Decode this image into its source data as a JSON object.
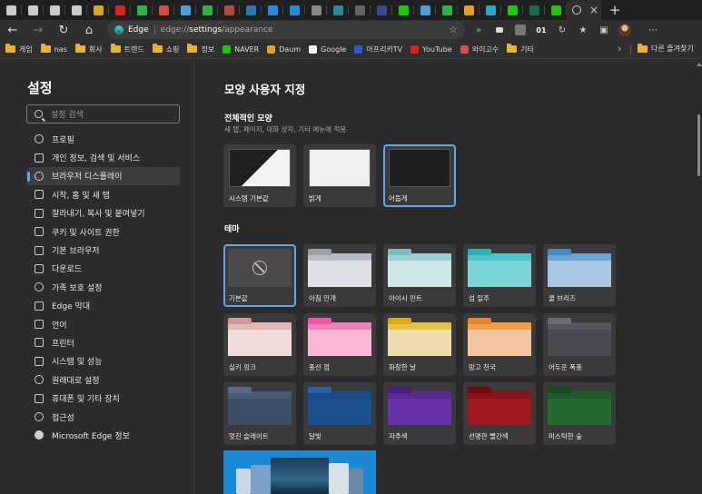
{
  "browser": {
    "tabs": [
      {
        "icon": "tab-actions-icon",
        "color": "#cccccc"
      },
      {
        "icon": "page-icon",
        "color": "#cccccc"
      },
      {
        "icon": "page-icon",
        "color": "#cccccc"
      },
      {
        "icon": "page-icon",
        "color": "#cccccc"
      },
      {
        "icon": "pac-icon",
        "color": "#d9a520"
      },
      {
        "icon": "youtube-icon",
        "color": "#e02020"
      },
      {
        "icon": "green-app-icon",
        "color": "#2db34a"
      },
      {
        "icon": "mail-icon",
        "color": "#d64b3a"
      },
      {
        "icon": "pinwheel-icon",
        "color": "#4aa0d8"
      },
      {
        "icon": "green-app-icon",
        "color": "#2db34a"
      },
      {
        "icon": "red-app-icon",
        "color": "#b44b3a"
      },
      {
        "icon": "wave-icon",
        "color": "#2a7ab8"
      },
      {
        "icon": "cloud-icon",
        "color": "#2a8cd8"
      },
      {
        "icon": "cloud-icon",
        "color": "#2a8cd8"
      },
      {
        "icon": "slash-icon",
        "color": "#888888"
      },
      {
        "icon": "globe-icon",
        "color": "#2a8a9a"
      },
      {
        "icon": "image-icon",
        "color": "#666666"
      },
      {
        "icon": "film-icon",
        "color": "#3a4a8a"
      },
      {
        "icon": "naver-icon",
        "color": "#1ec800"
      },
      {
        "icon": "pinwheel-icon",
        "color": "#4aa0d8"
      },
      {
        "icon": "green-app-icon",
        "color": "#2db34a"
      },
      {
        "icon": "bars-icon",
        "color": "#e0a020"
      },
      {
        "icon": "cyan-app-icon",
        "color": "#2aa8c8"
      },
      {
        "icon": "naver-icon",
        "color": "#1ec800"
      },
      {
        "icon": "leaf-icon",
        "color": "#1b6b4f"
      },
      {
        "icon": "naver-icon",
        "color": "#1ec800"
      }
    ],
    "active_tab_icon": "settings-icon",
    "address": {
      "site_label": "Edge",
      "url_prefix": "edge://",
      "url_bold": "settings",
      "url_suffix": "/appearance"
    },
    "toolbar_label_01": "01",
    "favorites": [
      {
        "type": "folder",
        "label": "게임"
      },
      {
        "type": "folder",
        "label": "nas"
      },
      {
        "type": "folder",
        "label": "회사"
      },
      {
        "type": "folder",
        "label": "트렌드"
      },
      {
        "type": "folder",
        "label": "쇼핑"
      },
      {
        "type": "folder",
        "label": "정보"
      },
      {
        "type": "site",
        "label": "NAVER",
        "color": "#1ec800"
      },
      {
        "type": "site",
        "label": "Daum",
        "color": "#e8a020"
      },
      {
        "type": "site",
        "label": "Google",
        "color": "#ffffff"
      },
      {
        "type": "site",
        "label": "아프리카TV",
        "color": "#2a5ad8"
      },
      {
        "type": "site",
        "label": "YouTube",
        "color": "#e02020"
      },
      {
        "type": "site",
        "label": "와이고수",
        "color": "#d84a5a"
      },
      {
        "type": "folder",
        "label": "기타"
      }
    ],
    "other_favorites": "다른 즐겨찾기"
  },
  "sidebar": {
    "title": "설정",
    "search_placeholder": "설정 검색",
    "items": [
      {
        "label": "프로필",
        "name": "profile",
        "icon": "round"
      },
      {
        "label": "개인 정보, 검색 및 서비스",
        "name": "privacy",
        "icon": "lock"
      },
      {
        "label": "브라우저 디스플레이",
        "name": "appearance",
        "icon": "round",
        "active": true
      },
      {
        "label": "시작, 홈 및 새 탭",
        "name": "start-home",
        "icon": "square"
      },
      {
        "label": "잘라내기, 복사 및 붙여넣기",
        "name": "share-copy-paste",
        "icon": "square"
      },
      {
        "label": "쿠키 및 사이트 권한",
        "name": "cookies",
        "icon": "square"
      },
      {
        "label": "기본 브라우저",
        "name": "default-browser",
        "icon": "square"
      },
      {
        "label": "다운로드",
        "name": "downloads",
        "icon": "arrow"
      },
      {
        "label": "가족 보호 설정",
        "name": "family",
        "icon": "round"
      },
      {
        "label": "Edge 막대",
        "name": "edge-bar",
        "icon": "square"
      },
      {
        "label": "언어",
        "name": "languages",
        "icon": "square"
      },
      {
        "label": "프린터",
        "name": "printers",
        "icon": "square"
      },
      {
        "label": "시스템 및 성능",
        "name": "system",
        "icon": "square"
      },
      {
        "label": "원래대로 설정",
        "name": "reset",
        "icon": "round"
      },
      {
        "label": "휴대폰 및 기타 장치",
        "name": "phone",
        "icon": "square"
      },
      {
        "label": "접근성",
        "name": "accessibility",
        "icon": "round"
      },
      {
        "label": "Microsoft Edge 정보",
        "name": "about",
        "icon": "solid"
      }
    ]
  },
  "main": {
    "title": "모양 사용자 지정",
    "overall": {
      "heading": "전체적인 모양",
      "subtext": "새 탭, 페이지, 대화 상자, 기타 메뉴에 적용",
      "options": [
        {
          "label": "시스템 기본값",
          "name": "system-default",
          "selected": false
        },
        {
          "label": "밝게",
          "name": "light",
          "selected": false
        },
        {
          "label": "어둡게",
          "name": "dark",
          "selected": true
        }
      ]
    },
    "theme": {
      "heading": "테마",
      "items": [
        {
          "label": "기본값",
          "name": "default",
          "band": "#4a4a4a",
          "body": "#4a4a4a",
          "tab": "#4a4a4a",
          "selected": true,
          "none": true
        },
        {
          "label": "아침 안개",
          "name": "morning-fog",
          "band": "#b8bcc4",
          "body": "#dfe1e6",
          "tab": "#9aa0aa"
        },
        {
          "label": "아이시 민트",
          "name": "icy-mint",
          "band": "#9fd0d4",
          "body": "#cfe6e8",
          "tab": "#7cbcc2"
        },
        {
          "label": "섬 일주",
          "name": "island-getaway",
          "band": "#4cc6c8",
          "body": "#7ad6d6",
          "tab": "#2fb0b8"
        },
        {
          "label": "쿨 브리즈",
          "name": "cool-breeze",
          "band": "#6aa4d4",
          "body": "#a9c6e2",
          "tab": "#4a88c4"
        },
        {
          "label": "실키 핑크",
          "name": "silky-pink",
          "band": "#e2b8b8",
          "body": "#f1dcdc",
          "tab": "#d09a9a"
        },
        {
          "label": "풍선 껌",
          "name": "bubblegum",
          "band": "#f27db8",
          "body": "#f8b6d4",
          "tab": "#ea5aa4"
        },
        {
          "label": "화창한 날",
          "name": "sunny-day",
          "band": "#e6c23a",
          "body": "#ecdcae",
          "tab": "#d8a91a"
        },
        {
          "label": "망고 천국",
          "name": "mango-paradise",
          "band": "#f0a040",
          "body": "#f2c6a0",
          "tab": "#e4862a"
        },
        {
          "label": "어두운 폭풍",
          "name": "dark-storm",
          "band": "#56565e",
          "body": "#4a4a52",
          "tab": "#6a6a72"
        },
        {
          "label": "멋진 슬레이트",
          "name": "cool-slate",
          "band": "#4a5a76",
          "body": "#3e4e68",
          "tab": "#5a6a86"
        },
        {
          "label": "달빛",
          "name": "moonlight",
          "band": "#1a4a88",
          "body": "#1c4f8e",
          "tab": "#2a60a8"
        },
        {
          "label": "자주색",
          "name": "juicy-plum",
          "band": "#5a2a94",
          "body": "#6a32a8",
          "tab": "#4a1e80"
        },
        {
          "label": "선명한 빨간색",
          "name": "spicy-red",
          "band": "#8a1018",
          "body": "#a01820",
          "tab": "#760a12"
        },
        {
          "label": "미스틱한 숲",
          "name": "mystical-forest",
          "band": "#1e5a2a",
          "body": "#246a32",
          "tab": "#184a22"
        }
      ]
    }
  }
}
